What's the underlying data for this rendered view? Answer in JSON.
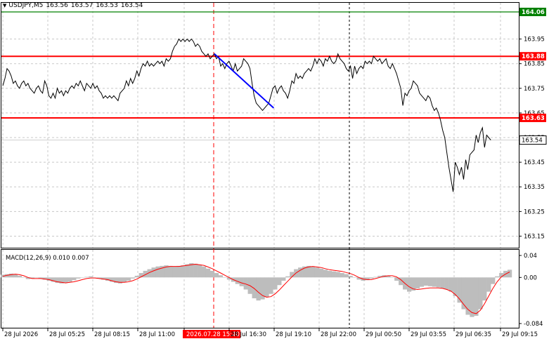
{
  "header": {
    "symbol": "USDJPY,M5",
    "open": "163.56",
    "high": "163.57",
    "low": "163.53",
    "close": "163.54",
    "collapse_glyph": "▼"
  },
  "colors": {
    "background": "#ffffff",
    "price_line": "#000000",
    "grid": "#c8c8c8",
    "resistance_line": "#ff0000",
    "top_level_line": "#008000",
    "trend_line": "#0000ff",
    "vline_red": "#ff0000",
    "vline_black": "#000000",
    "macd_hist": "#bdbdbd",
    "macd_signal": "#ff0000",
    "current_price_tag": "#ffffff"
  },
  "chart_data": [
    {
      "type": "line",
      "title": "",
      "ylim": [
        163.1,
        164.06
      ],
      "y_ticks": [
        "163.95",
        "163.85",
        "163.75",
        "163.65",
        "163.55",
        "163.45",
        "163.35",
        "163.25",
        "163.15"
      ],
      "x": [
        0,
        3,
        6,
        9,
        12,
        15,
        18,
        21,
        24,
        27,
        30,
        33,
        36,
        39,
        42,
        45,
        48,
        51,
        54,
        57,
        60,
        63,
        66,
        69,
        72,
        75,
        78,
        81,
        84,
        87,
        90,
        93,
        96,
        99,
        102,
        105,
        108,
        111,
        114,
        117,
        120,
        123,
        126,
        129,
        132,
        135,
        138,
        141,
        144,
        147,
        150,
        153,
        156,
        159,
        162,
        165,
        168,
        171,
        174,
        177,
        180,
        183,
        186,
        189,
        192,
        195,
        198,
        201,
        204,
        207,
        210,
        213,
        216,
        219,
        222,
        225,
        228,
        231,
        234,
        237,
        240,
        243,
        246,
        249,
        252,
        255,
        258,
        261,
        264,
        267,
        270,
        273,
        276,
        279,
        282,
        285,
        288,
        291,
        294,
        297,
        300,
        303,
        306,
        309,
        312,
        315,
        318,
        321,
        324,
        327,
        330,
        333,
        336,
        339,
        342,
        345,
        348,
        351,
        354,
        357,
        360,
        363,
        366,
        369,
        372,
        375,
        378,
        381,
        384,
        387,
        390,
        393,
        396,
        399,
        402,
        405,
        408,
        411,
        414,
        417,
        420,
        423,
        426,
        429,
        432,
        435,
        438,
        441,
        444,
        447,
        450,
        453,
        456,
        459,
        462,
        465,
        468,
        471,
        474,
        477,
        480,
        483,
        486,
        489,
        492,
        495,
        498,
        501,
        504,
        507,
        510,
        513,
        516,
        519,
        522,
        525,
        528,
        531,
        534,
        537,
        540,
        543,
        546,
        549,
        552,
        555,
        558,
        561,
        564,
        567,
        570,
        573,
        576,
        579,
        582,
        585,
        588,
        591,
        594,
        597,
        600,
        603,
        606,
        609,
        612,
        615,
        618,
        621,
        624,
        627,
        630,
        633,
        636,
        639,
        642,
        645,
        648,
        651,
        654,
        657,
        660,
        663,
        666,
        669,
        672,
        675,
        678,
        681,
        684,
        687,
        690,
        693,
        696,
        699,
        702,
        705,
        708,
        711,
        714,
        717,
        720,
        723,
        726
      ],
      "series": [
        {
          "values": [
            163.76,
            163.79,
            163.83,
            163.82,
            163.8,
            163.77,
            163.78,
            163.76,
            163.75,
            163.77,
            163.78,
            163.76,
            163.77,
            163.75,
            163.74,
            163.73,
            163.75,
            163.76,
            163.74,
            163.73,
            163.78,
            163.76,
            163.72,
            163.71,
            163.73,
            163.71,
            163.75,
            163.73,
            163.74,
            163.72,
            163.74,
            163.73,
            163.75,
            163.76,
            163.75,
            163.77,
            163.76,
            163.78,
            163.76,
            163.74,
            163.77,
            163.76,
            163.75,
            163.77,
            163.75,
            163.76,
            163.74,
            163.73,
            163.71,
            163.72,
            163.71,
            163.72,
            163.71,
            163.72,
            163.71,
            163.7,
            163.73,
            163.74,
            163.75,
            163.78,
            163.76,
            163.79,
            163.77,
            163.79,
            163.82,
            163.8,
            163.83,
            163.85,
            163.84,
            163.86,
            163.84,
            163.85,
            163.84,
            163.85,
            163.86,
            163.85,
            163.86,
            163.84,
            163.87,
            163.86,
            163.87,
            163.9,
            163.92,
            163.93,
            163.95,
            163.94,
            163.95,
            163.94,
            163.95,
            163.94,
            163.95,
            163.94,
            163.92,
            163.93,
            163.92,
            163.9,
            163.89,
            163.88,
            163.89,
            163.87,
            163.88,
            163.89,
            163.87,
            163.88,
            163.84,
            163.85,
            163.83,
            163.85,
            163.86,
            163.84,
            163.82,
            163.85,
            163.82,
            163.83,
            163.84,
            163.87,
            163.86,
            163.85,
            163.83,
            163.77,
            163.72,
            163.69,
            163.68,
            163.67,
            163.66,
            163.67,
            163.68,
            163.69,
            163.72,
            163.75,
            163.76,
            163.73,
            163.75,
            163.76,
            163.74,
            163.73,
            163.71,
            163.74,
            163.78,
            163.77,
            163.81,
            163.79,
            163.8,
            163.79,
            163.81,
            163.82,
            163.83,
            163.82,
            163.84,
            163.87,
            163.85,
            163.87,
            163.86,
            163.84,
            163.87,
            163.86,
            163.88,
            163.86,
            163.85,
            163.86,
            163.89,
            163.87,
            163.86,
            163.85,
            163.83,
            163.82,
            163.84,
            163.79,
            163.84,
            163.81,
            163.83,
            163.84,
            163.83,
            163.86,
            163.85,
            163.86,
            163.85,
            163.88,
            163.87,
            163.86,
            163.87,
            163.85,
            163.86,
            163.87,
            163.84,
            163.83,
            163.85,
            163.83,
            163.81,
            163.78,
            163.75,
            163.68,
            163.73,
            163.72,
            163.74,
            163.75,
            163.78,
            163.77,
            163.76,
            163.73,
            163.72,
            163.71,
            163.7,
            163.72,
            163.71,
            163.68,
            163.66,
            163.67,
            163.65,
            163.62,
            163.58,
            163.55,
            163.49,
            163.43,
            163.38,
            163.33,
            163.45,
            163.43,
            163.4,
            163.43,
            163.38,
            163.46,
            163.42,
            163.48,
            163.49,
            163.5,
            163.56,
            163.53,
            163.57,
            163.59,
            163.51,
            163.56,
            163.55,
            163.54
          ]
        }
      ],
      "horizontal_levels": [
        {
          "label": "164.06",
          "value": 164.06,
          "color": "#008000",
          "tag_bg": "#008000"
        },
        {
          "label": "163.88",
          "value": 163.88,
          "color": "#ff0000",
          "tag_bg": "#ff0000"
        },
        {
          "label": "163.63",
          "value": 163.63,
          "color": "#ff0000",
          "tag_bg": "#ff0000"
        }
      ],
      "current_price": {
        "label": "163.54",
        "value": 163.54
      },
      "trend_line": {
        "x": [
          303,
          388
        ],
        "values": [
          163.89,
          163.67
        ]
      }
    },
    {
      "type": "line",
      "title": "",
      "legend_label": "MACD(12,26,9) 0.010 0.007",
      "ylim": [
        -0.084,
        0.04
      ],
      "y_ticks": [
        "0.04",
        "0.00",
        "-0.084"
      ],
      "x": [
        0,
        6,
        12,
        18,
        24,
        30,
        36,
        42,
        48,
        54,
        60,
        66,
        72,
        78,
        84,
        90,
        96,
        102,
        108,
        114,
        120,
        126,
        132,
        138,
        144,
        150,
        156,
        162,
        168,
        174,
        180,
        186,
        192,
        198,
        204,
        210,
        216,
        222,
        228,
        234,
        240,
        246,
        252,
        258,
        264,
        270,
        276,
        282,
        288,
        294,
        300,
        306,
        312,
        318,
        324,
        330,
        336,
        342,
        348,
        354,
        360,
        366,
        372,
        378,
        384,
        390,
        396,
        402,
        408,
        414,
        420,
        426,
        432,
        438,
        444,
        450,
        456,
        462,
        468,
        474,
        480,
        486,
        492,
        498,
        504,
        510,
        516,
        522,
        528,
        534,
        540,
        546,
        552,
        558,
        564,
        570,
        576,
        582,
        588,
        594,
        600,
        606,
        612,
        618,
        624,
        630,
        636,
        642,
        648,
        654,
        660,
        666,
        672,
        678,
        684,
        690,
        696,
        702,
        708,
        714,
        720,
        726
      ],
      "series": [
        {
          "kind": "histogram",
          "values": [
            0.005,
            0.006,
            0.007,
            0.006,
            0.003,
            0.0,
            -0.003,
            -0.002,
            0.0,
            -0.002,
            -0.004,
            -0.006,
            -0.008,
            -0.01,
            -0.011,
            -0.01,
            -0.008,
            -0.005,
            -0.002,
            0.0,
            0.001,
            0.002,
            0.0,
            -0.002,
            -0.004,
            -0.006,
            -0.008,
            -0.01,
            -0.011,
            -0.009,
            -0.006,
            -0.002,
            0.003,
            0.008,
            0.012,
            0.015,
            0.018,
            0.02,
            0.021,
            0.022,
            0.021,
            0.02,
            0.021,
            0.022,
            0.024,
            0.026,
            0.025,
            0.023,
            0.02,
            0.016,
            0.012,
            0.008,
            0.004,
            0.0,
            -0.004,
            -0.008,
            -0.012,
            -0.016,
            -0.022,
            -0.03,
            -0.038,
            -0.042,
            -0.04,
            -0.036,
            -0.03,
            -0.022,
            -0.014,
            -0.006,
            0.002,
            0.01,
            0.015,
            0.018,
            0.02,
            0.021,
            0.02,
            0.018,
            0.016,
            0.014,
            0.012,
            0.011,
            0.01,
            0.008,
            0.006,
            0.003,
            0.0,
            -0.004,
            -0.006,
            -0.005,
            -0.002,
            0.001,
            0.003,
            0.004,
            0.003,
            0.0,
            -0.006,
            -0.014,
            -0.022,
            -0.026,
            -0.024,
            -0.02,
            -0.017,
            -0.015,
            -0.016,
            -0.017,
            -0.018,
            -0.02,
            -0.022,
            -0.026,
            -0.034,
            -0.046,
            -0.058,
            -0.068,
            -0.072,
            -0.07,
            -0.058,
            -0.042,
            -0.026,
            -0.012,
            0.002,
            0.008,
            0.012,
            0.014
          ]
        },
        {
          "kind": "signal",
          "values": [
            0.002,
            0.004,
            0.005,
            0.006,
            0.005,
            0.003,
            0.0,
            -0.002,
            -0.002,
            -0.002,
            -0.003,
            -0.004,
            -0.006,
            -0.008,
            -0.009,
            -0.01,
            -0.009,
            -0.008,
            -0.006,
            -0.004,
            -0.002,
            -0.001,
            -0.001,
            -0.002,
            -0.003,
            -0.004,
            -0.006,
            -0.008,
            -0.009,
            -0.009,
            -0.008,
            -0.006,
            -0.003,
            0.001,
            0.005,
            0.009,
            0.012,
            0.015,
            0.017,
            0.019,
            0.02,
            0.02,
            0.02,
            0.021,
            0.022,
            0.023,
            0.024,
            0.023,
            0.022,
            0.019,
            0.016,
            0.012,
            0.008,
            0.004,
            0.0,
            -0.004,
            -0.007,
            -0.01,
            -0.012,
            -0.015,
            -0.02,
            -0.027,
            -0.033,
            -0.036,
            -0.035,
            -0.03,
            -0.023,
            -0.015,
            -0.007,
            0.001,
            0.008,
            0.013,
            0.017,
            0.019,
            0.02,
            0.019,
            0.018,
            0.016,
            0.014,
            0.013,
            0.012,
            0.011,
            0.009,
            0.007,
            0.004,
            0.0,
            -0.003,
            -0.004,
            -0.004,
            -0.002,
            0.0,
            0.002,
            0.003,
            0.003,
            0.001,
            -0.004,
            -0.011,
            -0.017,
            -0.021,
            -0.022,
            -0.021,
            -0.02,
            -0.019,
            -0.019,
            -0.019,
            -0.02,
            -0.022,
            -0.025,
            -0.031,
            -0.039,
            -0.049,
            -0.058,
            -0.064,
            -0.066,
            -0.06,
            -0.048,
            -0.034,
            -0.02,
            -0.008,
            0.001,
            0.006,
            0.01
          ]
        }
      ]
    }
  ],
  "time_axis": {
    "labels": [
      "28 Jul 2026",
      "28 Jul 05:25",
      "28 Jul 08:15",
      "28 Jul 11:00",
      "2026.07.28 15:40",
      "28 Jul 16:30",
      "28 Jul 19:10",
      "28 Jul 22:00",
      "29 Jul 00:50",
      "29 Jul 03:55",
      "29 Jul 06:35",
      "29 Jul 09:15"
    ],
    "highlighted_index": 4,
    "highlight_bg": "#ff0000"
  }
}
